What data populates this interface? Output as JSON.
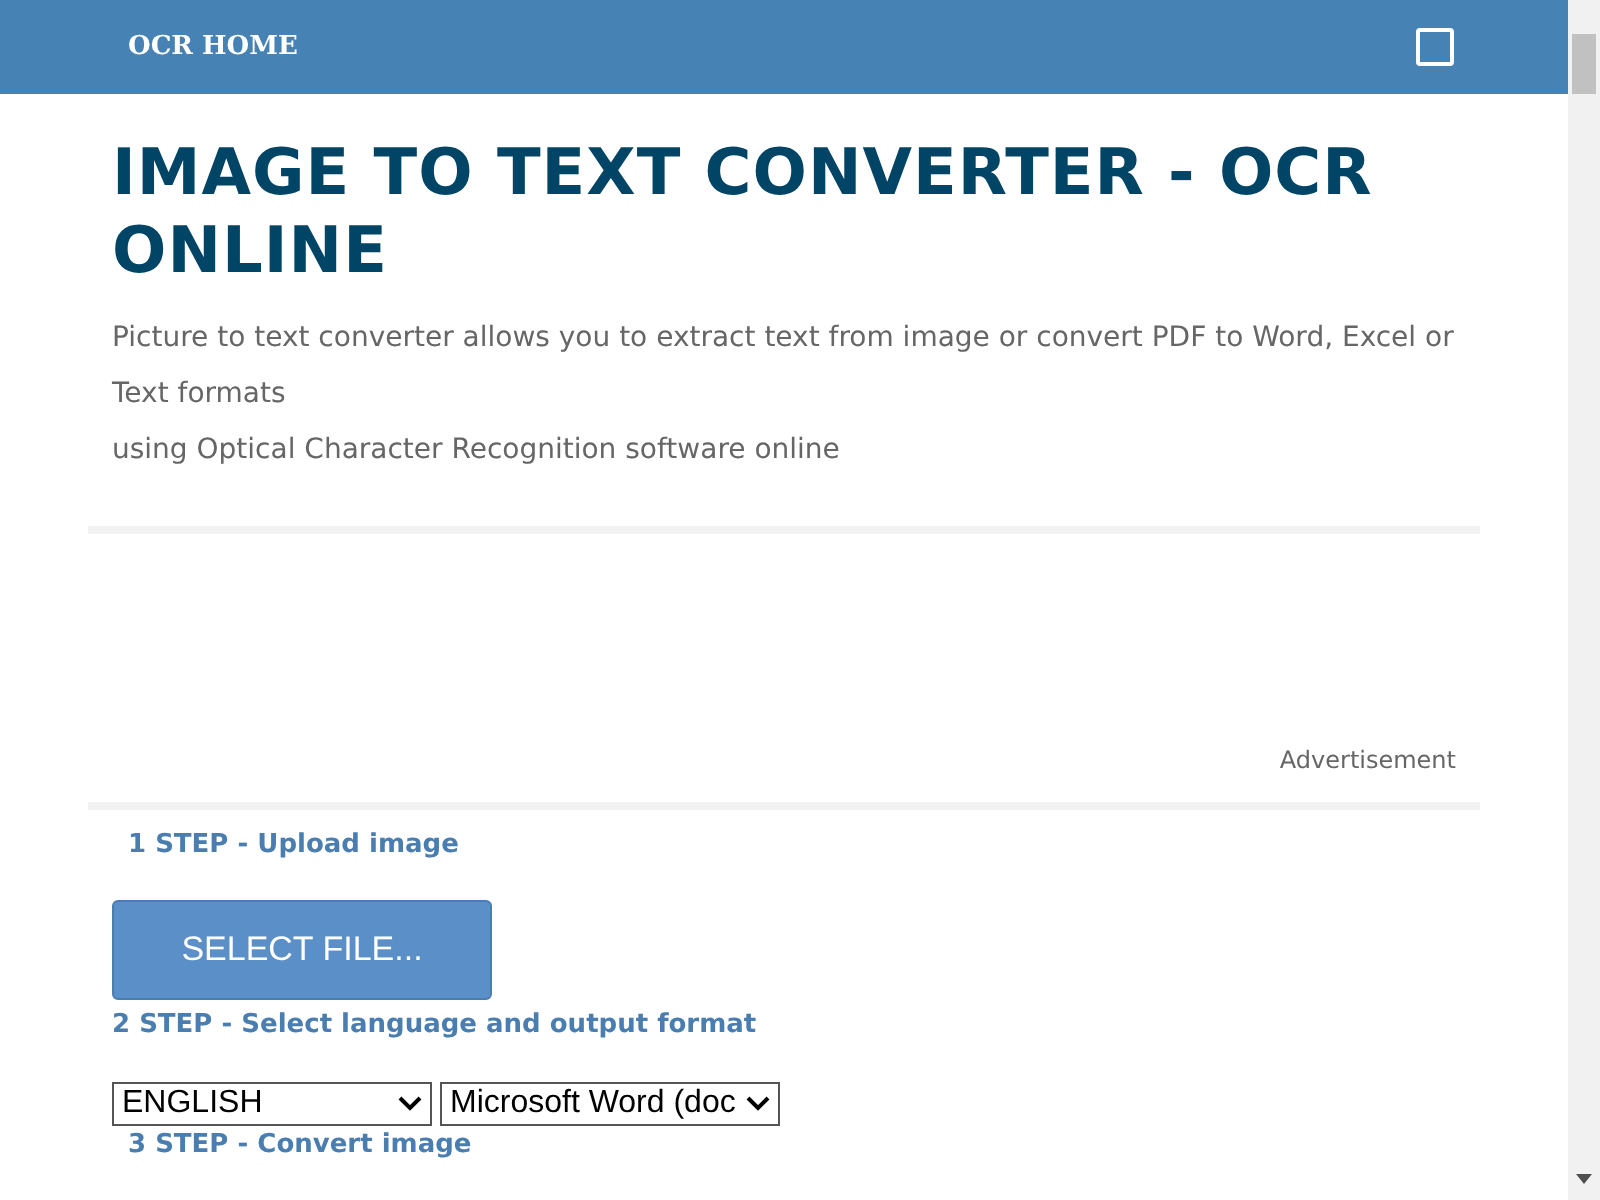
{
  "header": {
    "title": "OCR HOME"
  },
  "heading": "IMAGE TO TEXT CONVERTER - OCR ONLINE",
  "intro": [
    "Picture to text converter allows you to extract text from image or convert PDF to Word, Excel or Text formats",
    "using Optical Character Recognition software online"
  ],
  "ad": {
    "label": "Advertisement"
  },
  "steps": [
    {
      "label": "1 STEP - Upload image"
    },
    {
      "label": "2 STEP - Select language and output format"
    },
    {
      "label": "3 STEP - Convert image"
    }
  ],
  "select_file_button": "SELECT FILE...",
  "language_select": {
    "value": "ENGLISH"
  },
  "format_select": {
    "value": "Microsoft Word (doc"
  }
}
